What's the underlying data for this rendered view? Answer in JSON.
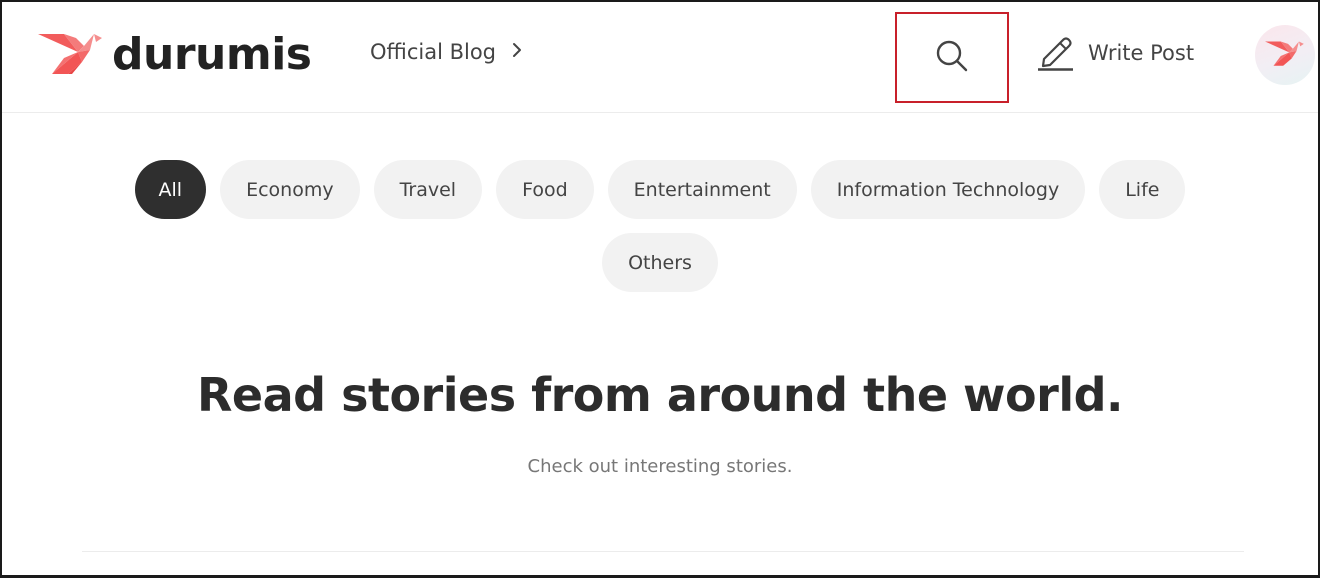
{
  "header": {
    "logo_text": "durumis",
    "breadcrumb_label": "Official Blog",
    "search_label": "Search",
    "write_post_label": "Write Post",
    "brand_color": "#f25c5c",
    "highlight_color": "#c8202a"
  },
  "icons": {
    "logo": "origami-bird-icon",
    "breadcrumb": "chevron-right-icon",
    "search": "search-icon",
    "write": "pencil-icon",
    "avatar": "origami-bird-icon"
  },
  "categories": {
    "selected": "All",
    "items": [
      {
        "label": "All",
        "active": true
      },
      {
        "label": "Economy",
        "active": false
      },
      {
        "label": "Travel",
        "active": false
      },
      {
        "label": "Food",
        "active": false
      },
      {
        "label": "Entertainment",
        "active": false
      },
      {
        "label": "Information Technology",
        "active": false
      },
      {
        "label": "Life",
        "active": false
      },
      {
        "label": "Others",
        "active": false
      }
    ]
  },
  "hero": {
    "title": "Read stories from around the world.",
    "subtitle": "Check out interesting stories."
  }
}
